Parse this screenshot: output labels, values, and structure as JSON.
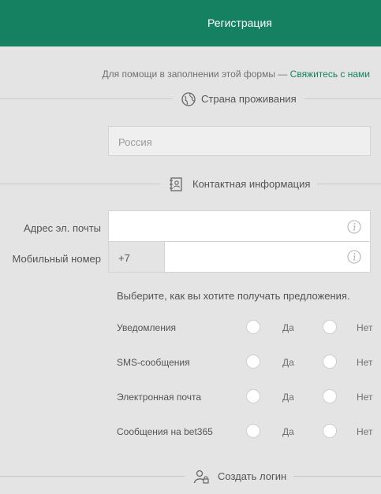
{
  "header": {
    "title": "Регистрация"
  },
  "help": {
    "text": "Для помощи в заполнении этой формы —",
    "link": "Свяжитесь с нами"
  },
  "sections": {
    "country": {
      "title": "Страна проживания"
    },
    "contact": {
      "title": "Контактная информация"
    },
    "login": {
      "title": "Создать логин"
    }
  },
  "country_field": {
    "placeholder": "Россия"
  },
  "email": {
    "label": "Адрес эл. почты",
    "value": ""
  },
  "mobile": {
    "label": "Мобильный номер",
    "prefix": "+7",
    "value": ""
  },
  "preferences": {
    "title": "Выберите, как вы хотите получать предложения.",
    "yes_label": "Да",
    "no_label": "Нет",
    "rows": [
      {
        "label": "Уведомления"
      },
      {
        "label": "SMS-сообщения"
      },
      {
        "label": "Электронная почта"
      },
      {
        "label": "Сообщения на bet365"
      }
    ]
  },
  "icons": {
    "country": "globe-icon",
    "contact": "contact-book-icon",
    "login": "user-lock-icon",
    "info": "info-icon"
  },
  "colors": {
    "brand": "#158160",
    "background": "#e4e4e4"
  }
}
